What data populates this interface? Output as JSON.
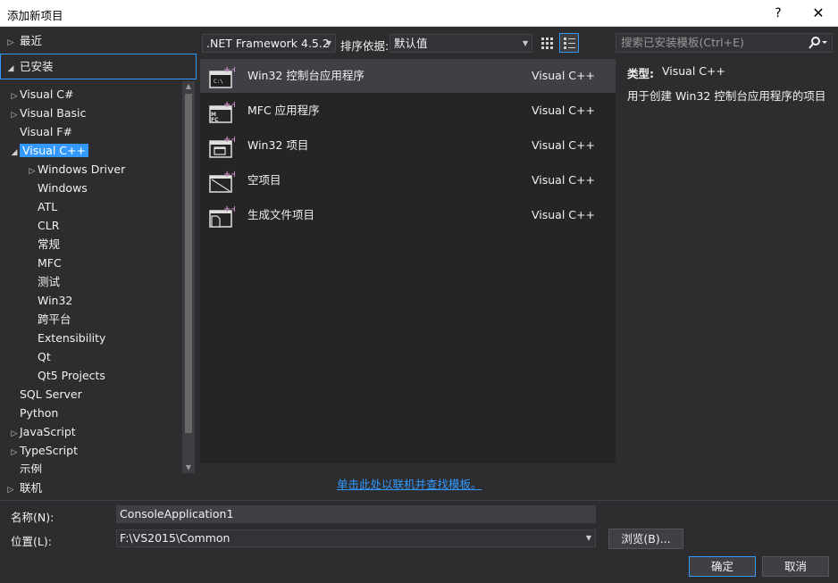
{
  "window": {
    "title": "添加新项目",
    "help_glyph": "?",
    "close_glyph": "✕"
  },
  "left_tree": {
    "recent": "最近",
    "installed": "已安装",
    "items": [
      {
        "label": "Visual C#",
        "expandable": true,
        "level": 1
      },
      {
        "label": "Visual Basic",
        "expandable": true,
        "level": 1
      },
      {
        "label": "Visual F#",
        "expandable": false,
        "level": 1
      },
      {
        "label": "Visual C++",
        "expandable": true,
        "expanded": true,
        "selected": true,
        "level": 1
      },
      {
        "label": "Windows Driver",
        "expandable": true,
        "level": 2
      },
      {
        "label": "Windows",
        "expandable": false,
        "level": 2
      },
      {
        "label": "ATL",
        "expandable": false,
        "level": 2
      },
      {
        "label": "CLR",
        "expandable": false,
        "level": 2
      },
      {
        "label": "常规",
        "expandable": false,
        "level": 2
      },
      {
        "label": "MFC",
        "expandable": false,
        "level": 2
      },
      {
        "label": "测试",
        "expandable": false,
        "level": 2
      },
      {
        "label": "Win32",
        "expandable": false,
        "level": 2
      },
      {
        "label": "跨平台",
        "expandable": false,
        "level": 2
      },
      {
        "label": "Extensibility",
        "expandable": false,
        "level": 2
      },
      {
        "label": "Qt",
        "expandable": false,
        "level": 2
      },
      {
        "label": "Qt5 Projects",
        "expandable": false,
        "level": 2
      },
      {
        "label": "SQL Server",
        "expandable": false,
        "level": 1
      },
      {
        "label": "Python",
        "expandable": false,
        "level": 1
      },
      {
        "label": "JavaScript",
        "expandable": true,
        "level": 1
      },
      {
        "label": "TypeScript",
        "expandable": true,
        "level": 1
      },
      {
        "label": "示例",
        "expandable": false,
        "level": 1
      }
    ],
    "online": "联机"
  },
  "toolbar": {
    "framework": ".NET Framework 4.5.2",
    "sort_label": "排序依据:",
    "sort_value": "默认值",
    "search_placeholder": "搜索已安装模板(Ctrl+E)"
  },
  "templates": [
    {
      "name": "Win32 控制台应用程序",
      "lang": "Visual C++",
      "icon": "console-app-icon",
      "selected": true
    },
    {
      "name": "MFC 应用程序",
      "lang": "Visual C++",
      "icon": "mfc-app-icon",
      "selected": false
    },
    {
      "name": "Win32 项目",
      "lang": "Visual C++",
      "icon": "win32-project-icon",
      "selected": false
    },
    {
      "name": "空项目",
      "lang": "Visual C++",
      "icon": "empty-project-icon",
      "selected": false
    },
    {
      "name": "生成文件项目",
      "lang": "Visual C++",
      "icon": "makefile-project-icon",
      "selected": false
    }
  ],
  "description": {
    "type_label": "类型:",
    "type_value": "Visual C++",
    "text": "用于创建 Win32 控制台应用程序的项目"
  },
  "online_link": "单击此处以联机并查找模板。",
  "form": {
    "name_label": "名称(N):",
    "name_value": "ConsoleApplication1",
    "location_label": "位置(L):",
    "location_value": "F:\\VS2015\\Common",
    "browse": "浏览(B)...",
    "ok": "确定",
    "cancel": "取消"
  },
  "colors": {
    "accent": "#3399ff",
    "background": "#2d2d30",
    "list_bg": "#252526",
    "plus_badge": "#c586c0"
  }
}
